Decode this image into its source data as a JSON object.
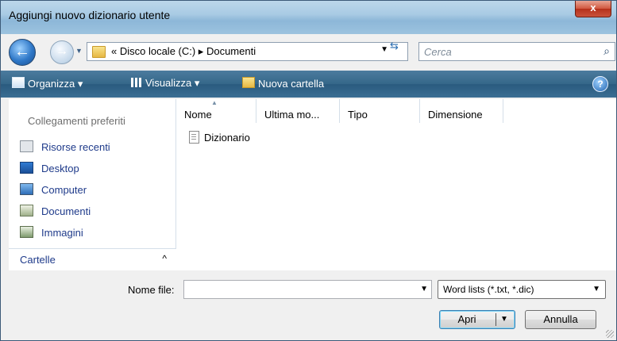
{
  "window": {
    "title": "Aggiungi nuovo dizionario utente",
    "close_label": "x"
  },
  "nav": {
    "back_glyph": "←",
    "forward_glyph": "→",
    "history_glyph": "▼",
    "address_text": "« Disco locale (C:) ▸ Documenti",
    "address_drop": "▼",
    "refresh_glyph": "⇆",
    "search_placeholder": "Cerca",
    "search_glyph": "⌕"
  },
  "toolbar": {
    "organize": "Organizza ▾",
    "view": "Visualizza ▾",
    "new_folder": "Nuova cartella",
    "help_glyph": "?"
  },
  "sidebar": {
    "favorites_header": "Collegamenti preferiti",
    "items": [
      {
        "label": "Risorse recenti",
        "icon": "recent-places-icon"
      },
      {
        "label": "Desktop",
        "icon": "desktop-icon"
      },
      {
        "label": "Computer",
        "icon": "computer-icon"
      },
      {
        "label": "Documenti",
        "icon": "documents-icon"
      },
      {
        "label": "Immagini",
        "icon": "pictures-icon"
      }
    ],
    "folders_label": "Cartelle",
    "folders_caret": "^"
  },
  "files": {
    "columns": [
      "Nome",
      "Ultima mo...",
      "Tipo",
      "Dimensione"
    ],
    "rows": [
      {
        "name": "Dizionario"
      }
    ]
  },
  "bottom": {
    "filename_label": "Nome file:",
    "filename_value": "",
    "filename_drop": "▼",
    "filetype_value": "Word lists (*.txt, *.dic)",
    "filetype_drop": "▼",
    "open_label": "Apri",
    "open_drop": "▼",
    "cancel_label": "Annulla"
  }
}
